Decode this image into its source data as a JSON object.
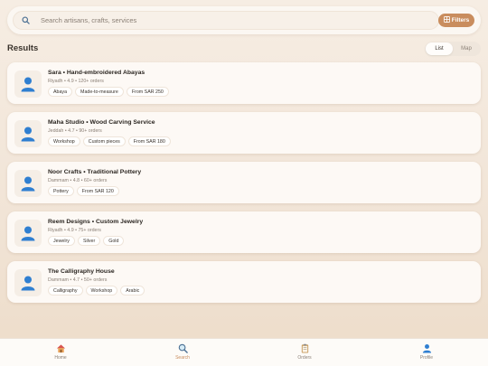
{
  "search": {
    "placeholder": "Search artisans, crafts, services",
    "filters_label": "Filters"
  },
  "results": {
    "title": "Results",
    "view_options": [
      "List",
      "Map"
    ],
    "active_view": "List"
  },
  "cards": [
    {
      "title": "Sara • Hand-embroidered Abayas",
      "meta": "Riyadh • 4.9 • 120+ orders",
      "tags": [
        "Abaya",
        "Made-to-measure",
        "From SAR 250"
      ]
    },
    {
      "title": "Maha Studio • Wood Carving Service",
      "meta": "Jeddah • 4.7 • 90+ orders",
      "tags": [
        "Workshop",
        "Custom pieces",
        "From SAR 180"
      ]
    },
    {
      "title": "Noor Crafts • Traditional Pottery",
      "meta": "Dammam • 4.8 • 60+ orders",
      "tags": [
        "Pottery",
        "From SAR 120"
      ]
    },
    {
      "title": "Reem Designs • Custom Jewelry",
      "meta": "Riyadh • 4.9 • 75+ orders",
      "tags": [
        "Jewelry",
        "Silver",
        "Gold"
      ]
    },
    {
      "title": "The Calligraphy House",
      "meta": "Dammam • 4.7 • 50+ orders",
      "tags": [
        "Calligraphy",
        "Workshop",
        "Arabic"
      ]
    }
  ],
  "nav": [
    {
      "label": "Home",
      "icon": "home-icon"
    },
    {
      "label": "Search",
      "icon": "search-icon"
    },
    {
      "label": "Orders",
      "icon": "clipboard-icon"
    },
    {
      "label": "Profile",
      "icon": "user-icon"
    }
  ],
  "colors": {
    "accent": "#c98d5e",
    "avatar": "#2f7fd1"
  }
}
